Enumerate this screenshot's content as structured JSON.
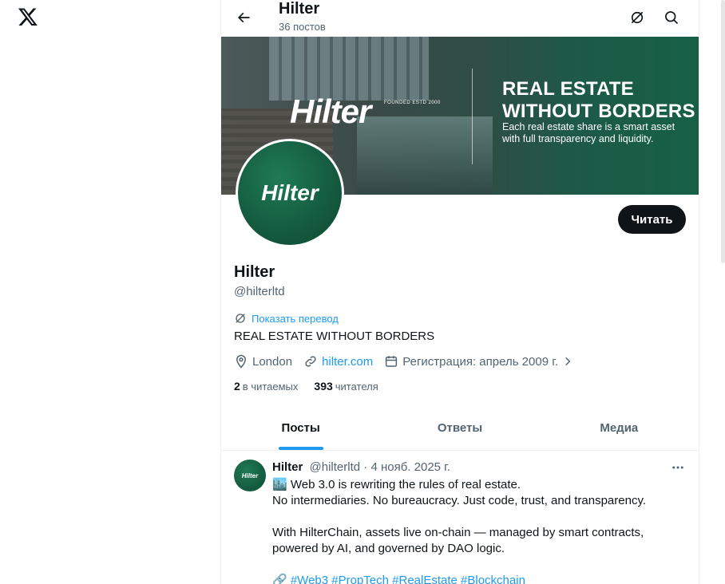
{
  "header": {
    "title": "Hilter",
    "subtitle": "36 постов"
  },
  "banner": {
    "brand": "Hilter",
    "brand_tag": "FOUNDED ESTD 2000",
    "headline_line1": "REAL ESTATE",
    "headline_line2": "WITHOUT BORDERS",
    "subline1": "Each real estate share is a smart asset",
    "subline2": "with full transparency and liquidity."
  },
  "avatar": {
    "logo_text": "Hilter"
  },
  "profile": {
    "follow_label": "Читать",
    "name": "Hilter",
    "handle": "@hilterltd",
    "translate_label": "Показать перевод",
    "bio": "REAL ESTATE WITHOUT BORDERS",
    "location": "London",
    "website": "hilter.com",
    "joined": "Регистрация: апрель 2009 г.",
    "following_count": "2",
    "following_label": "в читаемых",
    "followers_count": "393",
    "followers_label": "читателя"
  },
  "tabs": [
    "Посты",
    "Ответы",
    "Медиа"
  ],
  "tweet": {
    "name": "Hilter",
    "handle": "@hilterltd",
    "date": "· 4 нояб. 2025 г.",
    "line1": "🏙️ Web 3.0 is rewriting the rules of real estate.",
    "line2": "No intermediaries. No bureaucracy. Just code, trust, and transparency.",
    "line3": "With HilterChain, assets live on-chain — managed by smart contracts,",
    "line4": "powered by AI, and governed by DAO logic.",
    "hashtags": "🔗 #Web3 #PropTech #RealEstate #Blockchain"
  },
  "colors": {
    "accent": "#1d9bf0",
    "text": "#0f1419",
    "muted": "#536471",
    "brand_green": "#145a3e"
  }
}
